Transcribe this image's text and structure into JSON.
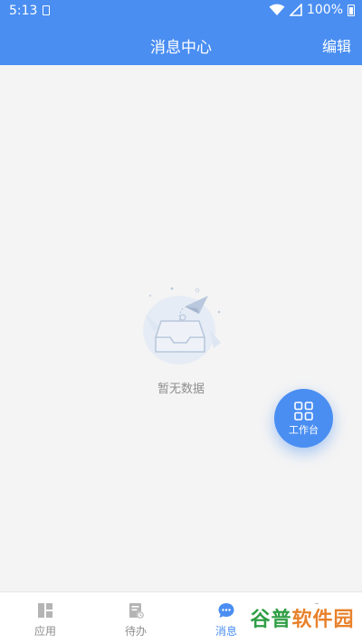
{
  "status_bar": {
    "time": "5:13",
    "battery_text": "100%"
  },
  "header": {
    "title": "消息中心",
    "edit_label": "编辑"
  },
  "empty_state": {
    "text": "暂无数据"
  },
  "fab": {
    "label": "工作台"
  },
  "tabbar": {
    "items": [
      {
        "label": "应用",
        "icon": "apps-icon",
        "active": false
      },
      {
        "label": "待办",
        "icon": "todo-icon",
        "active": false
      },
      {
        "label": "消息",
        "icon": "message-icon",
        "active": true
      },
      {
        "label": "",
        "icon": "user-icon",
        "active": false
      }
    ]
  },
  "watermark": {
    "part1": "谷普",
    "part2": "软件园"
  },
  "colors": {
    "primary": "#4a8ef2",
    "background": "#f4f4f4",
    "inactive": "#8e8e8e"
  }
}
